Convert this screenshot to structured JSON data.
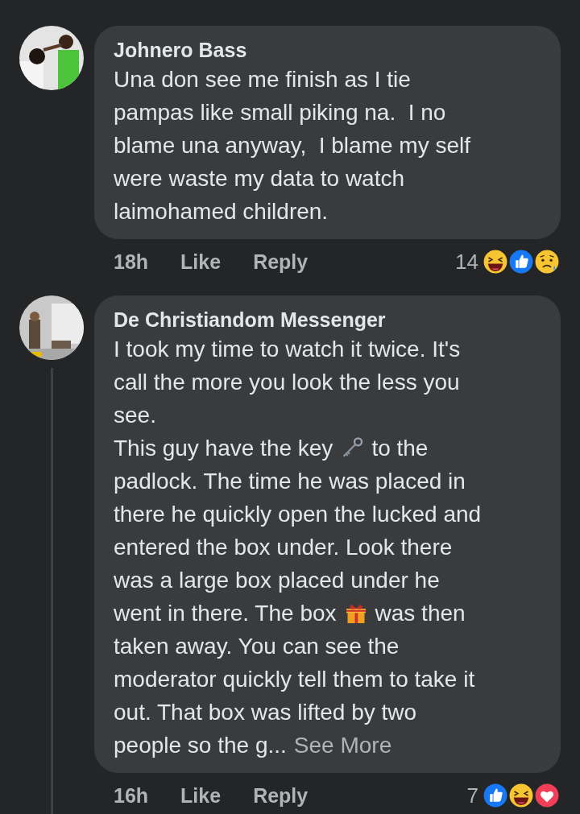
{
  "comments": [
    {
      "author": "Johnero Bass",
      "avatar": {
        "kind": "picture"
      },
      "has_replies": false,
      "body": [
        {
          "kind": "paragraph",
          "text": "Una don see me finish as I tie\npampas like small piking na.  I no\nblame una anyway,  I blame my self\nwere waste my data to watch\nlaimohamed children."
        }
      ],
      "time": "18h",
      "like": "Like",
      "reply": "Reply",
      "reaction_count": "14",
      "reactions": [
        {
          "kind": "haha"
        },
        {
          "kind": "like"
        },
        {
          "kind": "sad"
        }
      ]
    },
    {
      "author": "De Christiandom Messenger",
      "avatar": {
        "kind": "picture"
      },
      "has_replies": true,
      "body": [
        {
          "kind": "paragraph",
          "text": "I took my time to watch it twice. It's\ncall the more you look the less you\nsee."
        },
        {
          "kind": "line",
          "parts": [
            {
              "kind": "text",
              "text": "This guy have the key"
            },
            {
              "kind": "key"
            },
            {
              "kind": "text",
              "text": "to the"
            }
          ]
        },
        {
          "kind": "paragraph",
          "text": "padlock. The time he was placed in\nthere he quickly open the lucked and\nentered the box under. Look there\nwas a large box placed under he"
        },
        {
          "kind": "line",
          "parts": [
            {
              "kind": "text",
              "text": "went in there. The box"
            },
            {
              "kind": "gift"
            },
            {
              "kind": "text",
              "text": "was then"
            }
          ]
        },
        {
          "kind": "paragraph",
          "text": "taken away. You can see the\nmoderator quickly tell them to take it\nout. That box was lifted by two"
        },
        {
          "kind": "line",
          "parts": [
            {
              "kind": "text",
              "text": "people so the g..."
            },
            {
              "kind": "link",
              "text": "See More"
            }
          ]
        }
      ],
      "time": "16h",
      "like": "Like",
      "reply": "Reply",
      "reaction_count": "7",
      "reactions": [
        {
          "kind": "like"
        },
        {
          "kind": "haha"
        },
        {
          "kind": "love"
        }
      ]
    }
  ]
}
